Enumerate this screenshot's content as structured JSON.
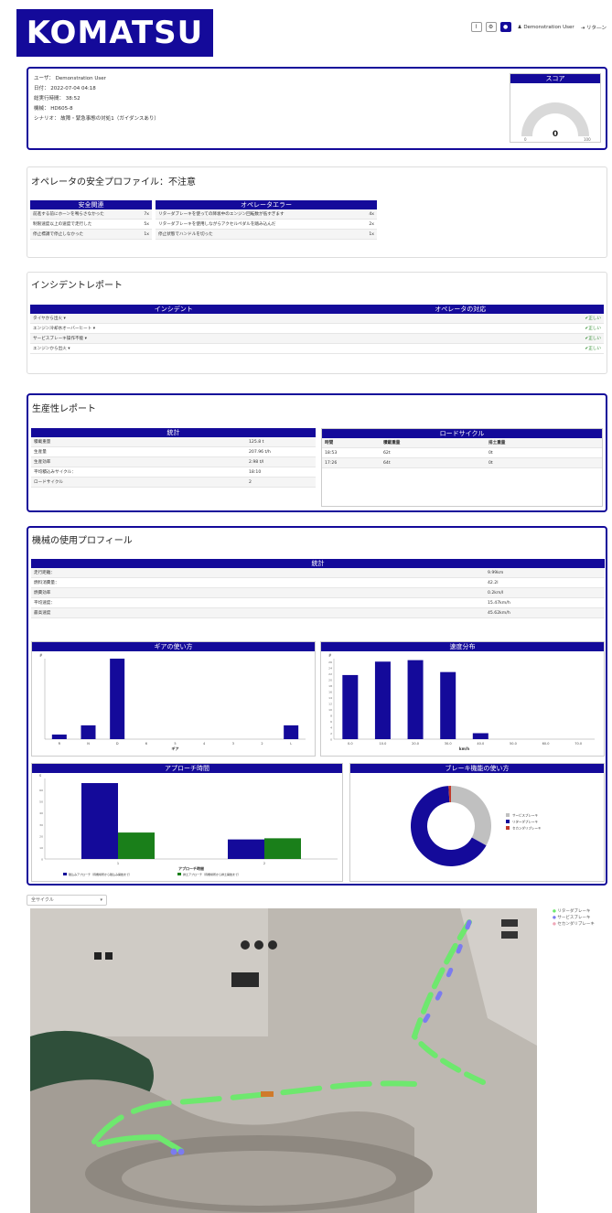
{
  "header": {
    "logo": "KOMATSU",
    "user_label": "Demonstration User",
    "retire_label": "リタ―ン"
  },
  "summary": {
    "user": "ユーザ：  Demonstration User",
    "date": "日付：  2022-07-04 04:18",
    "elapsed": "総実行時間：  38:52",
    "machine": "機械：  HD605-8",
    "scenario": "シナリオ：  故障・緊急事態の対処1（ガイダンスあり）",
    "score_title": "スコア",
    "score_value": "0",
    "score_min": "0",
    "score_max": "100"
  },
  "safety": {
    "title": "オペレータの安全プロファイル：不注意",
    "left_header": "安全関連",
    "left_rows": [
      {
        "label": "前進する前にホーンを鳴らさなかった",
        "count": "7x"
      },
      {
        "label": "制限速度以上の速度で走行した",
        "count": "5x"
      },
      {
        "label": "停止標識で停止しなかった",
        "count": "1x"
      }
    ],
    "right_header": "オペレータエラー",
    "right_rows": [
      {
        "label": "リターダブレーキを使っての降坂中のエンジン回転数が低すぎます",
        "count": "4x"
      },
      {
        "label": "リターダブレーキを使用しながらアクセルペダルを踏み込んだ",
        "count": "2x"
      },
      {
        "label": "停止状態でハンドルを切った",
        "count": "1x"
      }
    ]
  },
  "incident": {
    "title": "インシデントレポート",
    "col_incident": "インシデント",
    "col_response": "オペレータの対応",
    "rows": [
      {
        "label": "タイヤから出火 ▾",
        "result": "✔正しい"
      },
      {
        "label": "エンジン冷却水オーバーヒート ▾",
        "result": "✔正しい"
      },
      {
        "label": "サービスブレーキ操作不能 ▾",
        "result": "✔正しい"
      },
      {
        "label": "エンジンから出火 ▾",
        "result": "✔正しい"
      }
    ]
  },
  "productivity": {
    "title": "生産性レポート",
    "stats_header": "統計",
    "stats": [
      {
        "label": "積載重量",
        "value": "125.8 t"
      },
      {
        "label": "生産量",
        "value": "207.96 t/h"
      },
      {
        "label": "生産効率",
        "value": "2.98 t/l"
      },
      {
        "label": "平均積込みサイクル：",
        "value": "18:10"
      },
      {
        "label": "ロードサイクル",
        "value": "2"
      }
    ],
    "cycle_header": "ロードサイクル",
    "cycle_cols": [
      "時間",
      "積載重量",
      "排土重量"
    ],
    "cycles": [
      {
        "time": "18:53",
        "load": "62t",
        "dump": "0t"
      },
      {
        "time": "17:26",
        "load": "64t",
        "dump": "0t"
      }
    ]
  },
  "usage": {
    "title": "機械の使用プロフィール",
    "stats_header": "統計",
    "stats": [
      {
        "label": "走行距離：",
        "value": "9.99km"
      },
      {
        "label": "燃料消費量：",
        "value": "42.2l"
      },
      {
        "label": "燃費効率",
        "value": "0.2km/l"
      },
      {
        "label": "平均速度：",
        "value": "15.47km/h"
      },
      {
        "label": "最高速度",
        "value": "45.62km/h"
      }
    ],
    "gear_header": "ギアの使い方",
    "speed_header": "速度分布",
    "approach_header": "アプローチ時間",
    "brake_header": "ブレーキ機能の使い方"
  },
  "map": {
    "cycle_select": "全サイクル",
    "legend": [
      "リターダブレーキ",
      "サービスブレーキ",
      "セカンダリブレーキ"
    ]
  },
  "colors": {
    "navy": "#140a9a",
    "green": "#1a7f1a",
    "gray": "#c0c0c0",
    "red": "#c0392b",
    "map_green": "#6ee86e",
    "map_blue": "#7b7bf0"
  },
  "chart_data": [
    {
      "type": "bar",
      "title": "ギアの使い方",
      "ylabel": "#",
      "xlabel": "ギア",
      "categories": [
        "R",
        "N",
        "D",
        "6",
        "5",
        "4",
        "3",
        "2",
        "L"
      ],
      "values": [
        4,
        12,
        70,
        0,
        0,
        0,
        0,
        0,
        12
      ],
      "ylim": [
        0,
        70
      ]
    },
    {
      "type": "bar",
      "title": "速度分布",
      "ylabel": "#",
      "xlabel": "km/h",
      "categories": [
        "0.0",
        "10.0",
        "20.0",
        "30.0",
        "40.0",
        "50.0",
        "60.0",
        "70.0"
      ],
      "values": [
        21.5,
        26,
        26.5,
        22.5,
        2,
        0,
        0,
        0
      ],
      "yticks": [
        0,
        2,
        4,
        6,
        8,
        10,
        12,
        14,
        16,
        18,
        20,
        22,
        24,
        26
      ],
      "ylim": [
        0,
        27
      ]
    },
    {
      "type": "bar",
      "title": "アプローチ時間",
      "ylabel": "s",
      "xlabel": "アプローチ時間",
      "categories": [
        "1",
        "2"
      ],
      "series": [
        {
          "name": "積込みアプローチ（待機場所から積込み開始まで）",
          "values": [
            66,
            17
          ]
        },
        {
          "name": "排土アプローチ（待機場所から排土開始まで）",
          "values": [
            23,
            18
          ]
        }
      ],
      "yticks": [
        0,
        10,
        20,
        30,
        40,
        50,
        60
      ],
      "ylim": [
        0,
        70
      ]
    },
    {
      "type": "pie",
      "title": "ブレーキ機能の使い方",
      "labels": [
        "サービスブレーキ",
        "リターダブレーキ",
        "セカンダリブレーキ"
      ],
      "values": [
        33,
        66,
        1
      ]
    }
  ]
}
